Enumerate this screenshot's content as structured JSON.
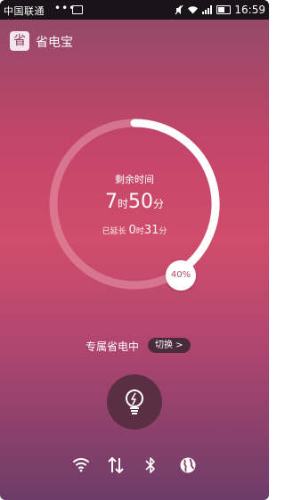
{
  "status_bar": {
    "carrier": "中国联通",
    "dots": "•••",
    "time": "16:59"
  },
  "app": {
    "title": "省电宝",
    "logo_text": "省"
  },
  "battery_panel": {
    "remaining_label": "剩余时间",
    "hours": "7",
    "hours_unit": "时",
    "minutes": "50",
    "minutes_unit": "分",
    "extended_label": "已延长",
    "extended_hours": "0",
    "extended_hours_unit": "时",
    "extended_minutes": "31",
    "extended_minutes_unit": "分",
    "percent_text": "40%",
    "percent_value": 0.4
  },
  "mode": {
    "label": "专属省电中",
    "switch_label": "切换 >"
  },
  "bottom_toggles": [
    "wifi-icon",
    "data-transfer-icon",
    "bluetooth-icon",
    "globe-icon"
  ],
  "colors": {
    "accent": "#c3456a",
    "ring_track": "#e89aae",
    "ring_fill": "#ffffff"
  }
}
